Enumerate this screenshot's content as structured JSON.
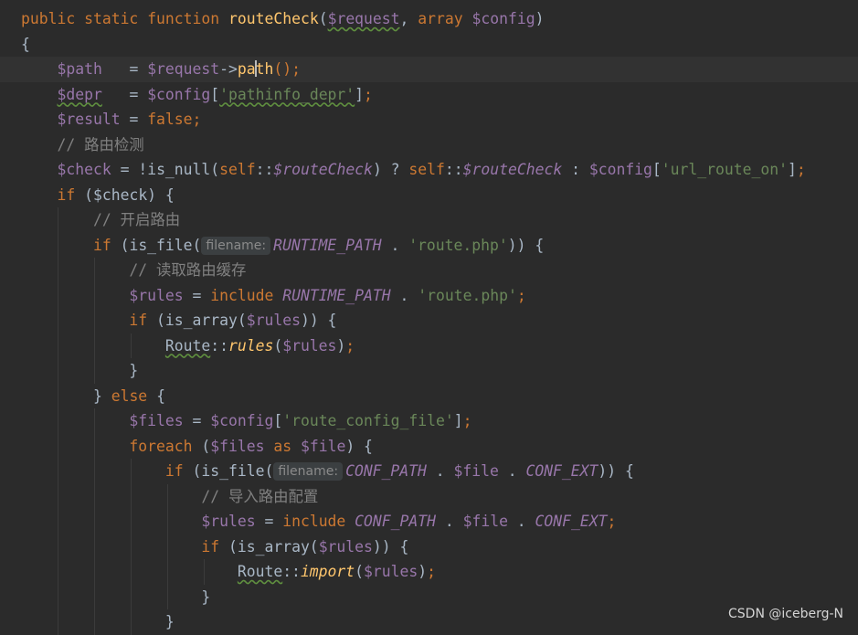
{
  "code_lines": [
    [
      "public static function routeCheck($request, array $config)"
    ],
    [
      "{"
    ],
    [
      "$path",
      "=",
      "$request",
      "->",
      "path",
      "();"
    ],
    [
      "$depr",
      "=",
      "$config",
      "'pathinfo_depr'"
    ],
    [
      "$result",
      "=",
      "false;"
    ],
    [
      "// 路由检测"
    ],
    [
      "$check",
      "=",
      "!is_null(",
      "self::",
      "$routeCheck",
      ") ?",
      "self::",
      "$routeCheck",
      ":",
      "$config",
      "'url_route_on'"
    ],
    [
      "if ($check) {"
    ],
    [
      "// 开启路由"
    ],
    [
      "if (is_file(",
      "filename:",
      "RUNTIME_PATH",
      ".",
      "'route.php'",
      ")) {"
    ],
    [
      "// 读取路由缓存"
    ],
    [
      "$rules",
      "=",
      "include",
      "RUNTIME_PATH",
      ".",
      "'route.php';"
    ],
    [
      "if (is_array($rules)) {"
    ],
    [
      "Route::rules($rules);"
    ],
    [
      "}"
    ],
    [
      "} else {"
    ],
    [
      "$files",
      "=",
      "$config",
      "'route_config_file'"
    ],
    [
      "foreach ($files as $file) {"
    ],
    [
      "if (is_file(",
      "filename:",
      "CONF_PATH . $file . CONF_EXT",
      ")) {"
    ],
    [
      "// 导入路由配置"
    ],
    [
      "$rules",
      "=",
      "include",
      "CONF_PATH . $file . CONF_EXT;"
    ],
    [
      "if (is_array($rules)) {"
    ],
    [
      "Route::import($rules);"
    ],
    [
      "}"
    ],
    [
      "}"
    ]
  ],
  "tokens": {
    "l1": {
      "public": "public",
      "static": "static",
      "function": "function",
      "name": "routeCheck",
      "p1": "$request",
      "array": "array",
      "p2": "$config"
    },
    "l2": "{",
    "l3": {
      "v": "$path",
      "eq": "=",
      "obj": "$request",
      "arrow": "->",
      "m1": "pa",
      "m2": "th",
      "tail": "();"
    },
    "l4": {
      "v": "$depr",
      "eq": "=",
      "obj": "$config",
      "key": "'pathinfo_depr'"
    },
    "l5": {
      "v": "$result",
      "eq": "=",
      "val": "false;"
    },
    "l6": "// 路由检测",
    "l7": {
      "v": "$check",
      "eq": "=",
      "call": "!is_null(",
      "self1": "self",
      "prop1": "$routeCheck",
      "q": ") ?",
      "self2": "self",
      "prop2": "$routeCheck",
      "colon": ":",
      "cfg": "$config",
      "key": "'url_route_on'"
    },
    "l8": {
      "if": "if",
      "cond": "($check) {"
    },
    "l9": "// 开启路由",
    "l10": {
      "if": "if",
      "call": "(is_file(",
      "hint": "filename:",
      "const": "RUNTIME_PATH",
      "dot": ".",
      "str": "'route.php'",
      "tail": ")) {"
    },
    "l11": "// 读取路由缓存",
    "l12": {
      "v": "$rules",
      "eq": "=",
      "include": "include",
      "const": "RUNTIME_PATH",
      "dot": ".",
      "str": "'route.php'"
    },
    "l13": {
      "if": "if",
      "call": "(is_array(",
      "v": "$rules",
      "tail": ")) {"
    },
    "l14": {
      "cls": "Route",
      "sep": "::",
      "m": "rules",
      "v": "$rules"
    },
    "l15": "}",
    "l16": {
      "close": "}",
      "else": "else",
      "open": "{"
    },
    "l17": {
      "v": "$files",
      "eq": "=",
      "obj": "$config",
      "key": "'route_config_file'"
    },
    "l18": {
      "foreach": "foreach",
      "v1": "$files",
      "as": "as",
      "v2": "$file",
      "open": ") {"
    },
    "l19": {
      "if": "if",
      "call": "(is_file(",
      "hint": "filename:",
      "c1": "CONF_PATH",
      "v": "$file",
      "c2": "CONF_EXT",
      "tail": ")) {"
    },
    "l20": "// 导入路由配置",
    "l21": {
      "v": "$rules",
      "eq": "=",
      "include": "include",
      "c1": "CONF_PATH",
      "v2": "$file",
      "c2": "CONF_EXT"
    },
    "l22": {
      "if": "if",
      "call": "(is_array(",
      "v": "$rules",
      "tail": ")) {"
    },
    "l23": {
      "cls": "Route",
      "sep": "::",
      "m": "import",
      "v": "$rules"
    },
    "l24": "}",
    "l25": "}"
  },
  "watermark": "CSDN @iceberg-N",
  "colors": {
    "background": "#2b2b2b",
    "current_line": "#323232",
    "keyword": "#cc7832",
    "function": "#ffc66d",
    "variable": "#9876aa",
    "string": "#6a8759",
    "comment": "#808080",
    "plain": "#a9b7c6"
  }
}
